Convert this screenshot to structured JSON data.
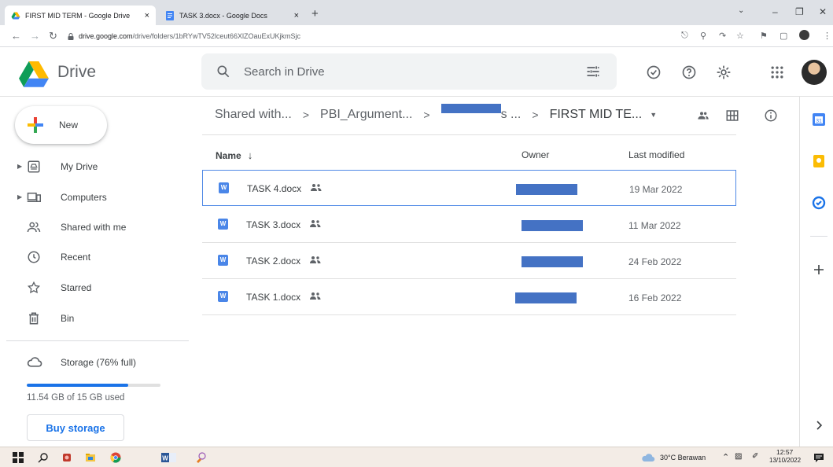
{
  "browser": {
    "tabs": [
      {
        "title": "FIRST MID TERM - Google Drive",
        "close": "×"
      },
      {
        "title": "TASK 3.docx - Google Docs",
        "close": "×"
      }
    ],
    "new_tab": "+",
    "url_host": "drive.google.com",
    "url_path": "/drive/folders/1bRYwTV52lceut66XlZOauExUKjkmSjc"
  },
  "header": {
    "app_name": "Drive",
    "search_placeholder": "Search in Drive"
  },
  "sidebar": {
    "new_label": "New",
    "items": [
      {
        "label": "My Drive",
        "icon": "my-drive-icon"
      },
      {
        "label": "Computers",
        "icon": "computers-icon"
      },
      {
        "label": "Shared with me",
        "icon": "shared-with-me-icon"
      },
      {
        "label": "Recent",
        "icon": "clock-icon"
      },
      {
        "label": "Starred",
        "icon": "star-icon"
      },
      {
        "label": "Bin",
        "icon": "trash-icon"
      }
    ],
    "storage_label": "Storage (76% full)",
    "storage_percent": 76,
    "storage_used": "11.54 GB of 15 GB used",
    "buy_storage": "Buy storage"
  },
  "breadcrumb": {
    "items": [
      "Shared with...",
      "PBI_Argument...",
      "",
      "FIRST MID TE..."
    ],
    "separator": ">",
    "suffix_after_redacted": "s ..."
  },
  "table": {
    "headers": {
      "name": "Name",
      "owner": "Owner",
      "modified": "Last modified"
    },
    "sort_arrow": "↓",
    "rows": [
      {
        "name": "TASK 4.docx",
        "modified": "19 Mar 2022",
        "selected": true
      },
      {
        "name": "TASK 3.docx",
        "modified": "11 Mar 2022",
        "selected": false
      },
      {
        "name": "TASK 2.docx",
        "modified": "24 Feb 2022",
        "selected": false
      },
      {
        "name": "TASK 1.docx",
        "modified": "16 Feb 2022",
        "selected": false
      }
    ],
    "file_badge": "W"
  },
  "taskbar": {
    "weather": "30°C  Berawan",
    "time": "12:57",
    "date": "13/10/2022"
  },
  "colors": {
    "accent": "#1a73e8",
    "redaction": "#4472c4",
    "word": "#4a86e8"
  }
}
